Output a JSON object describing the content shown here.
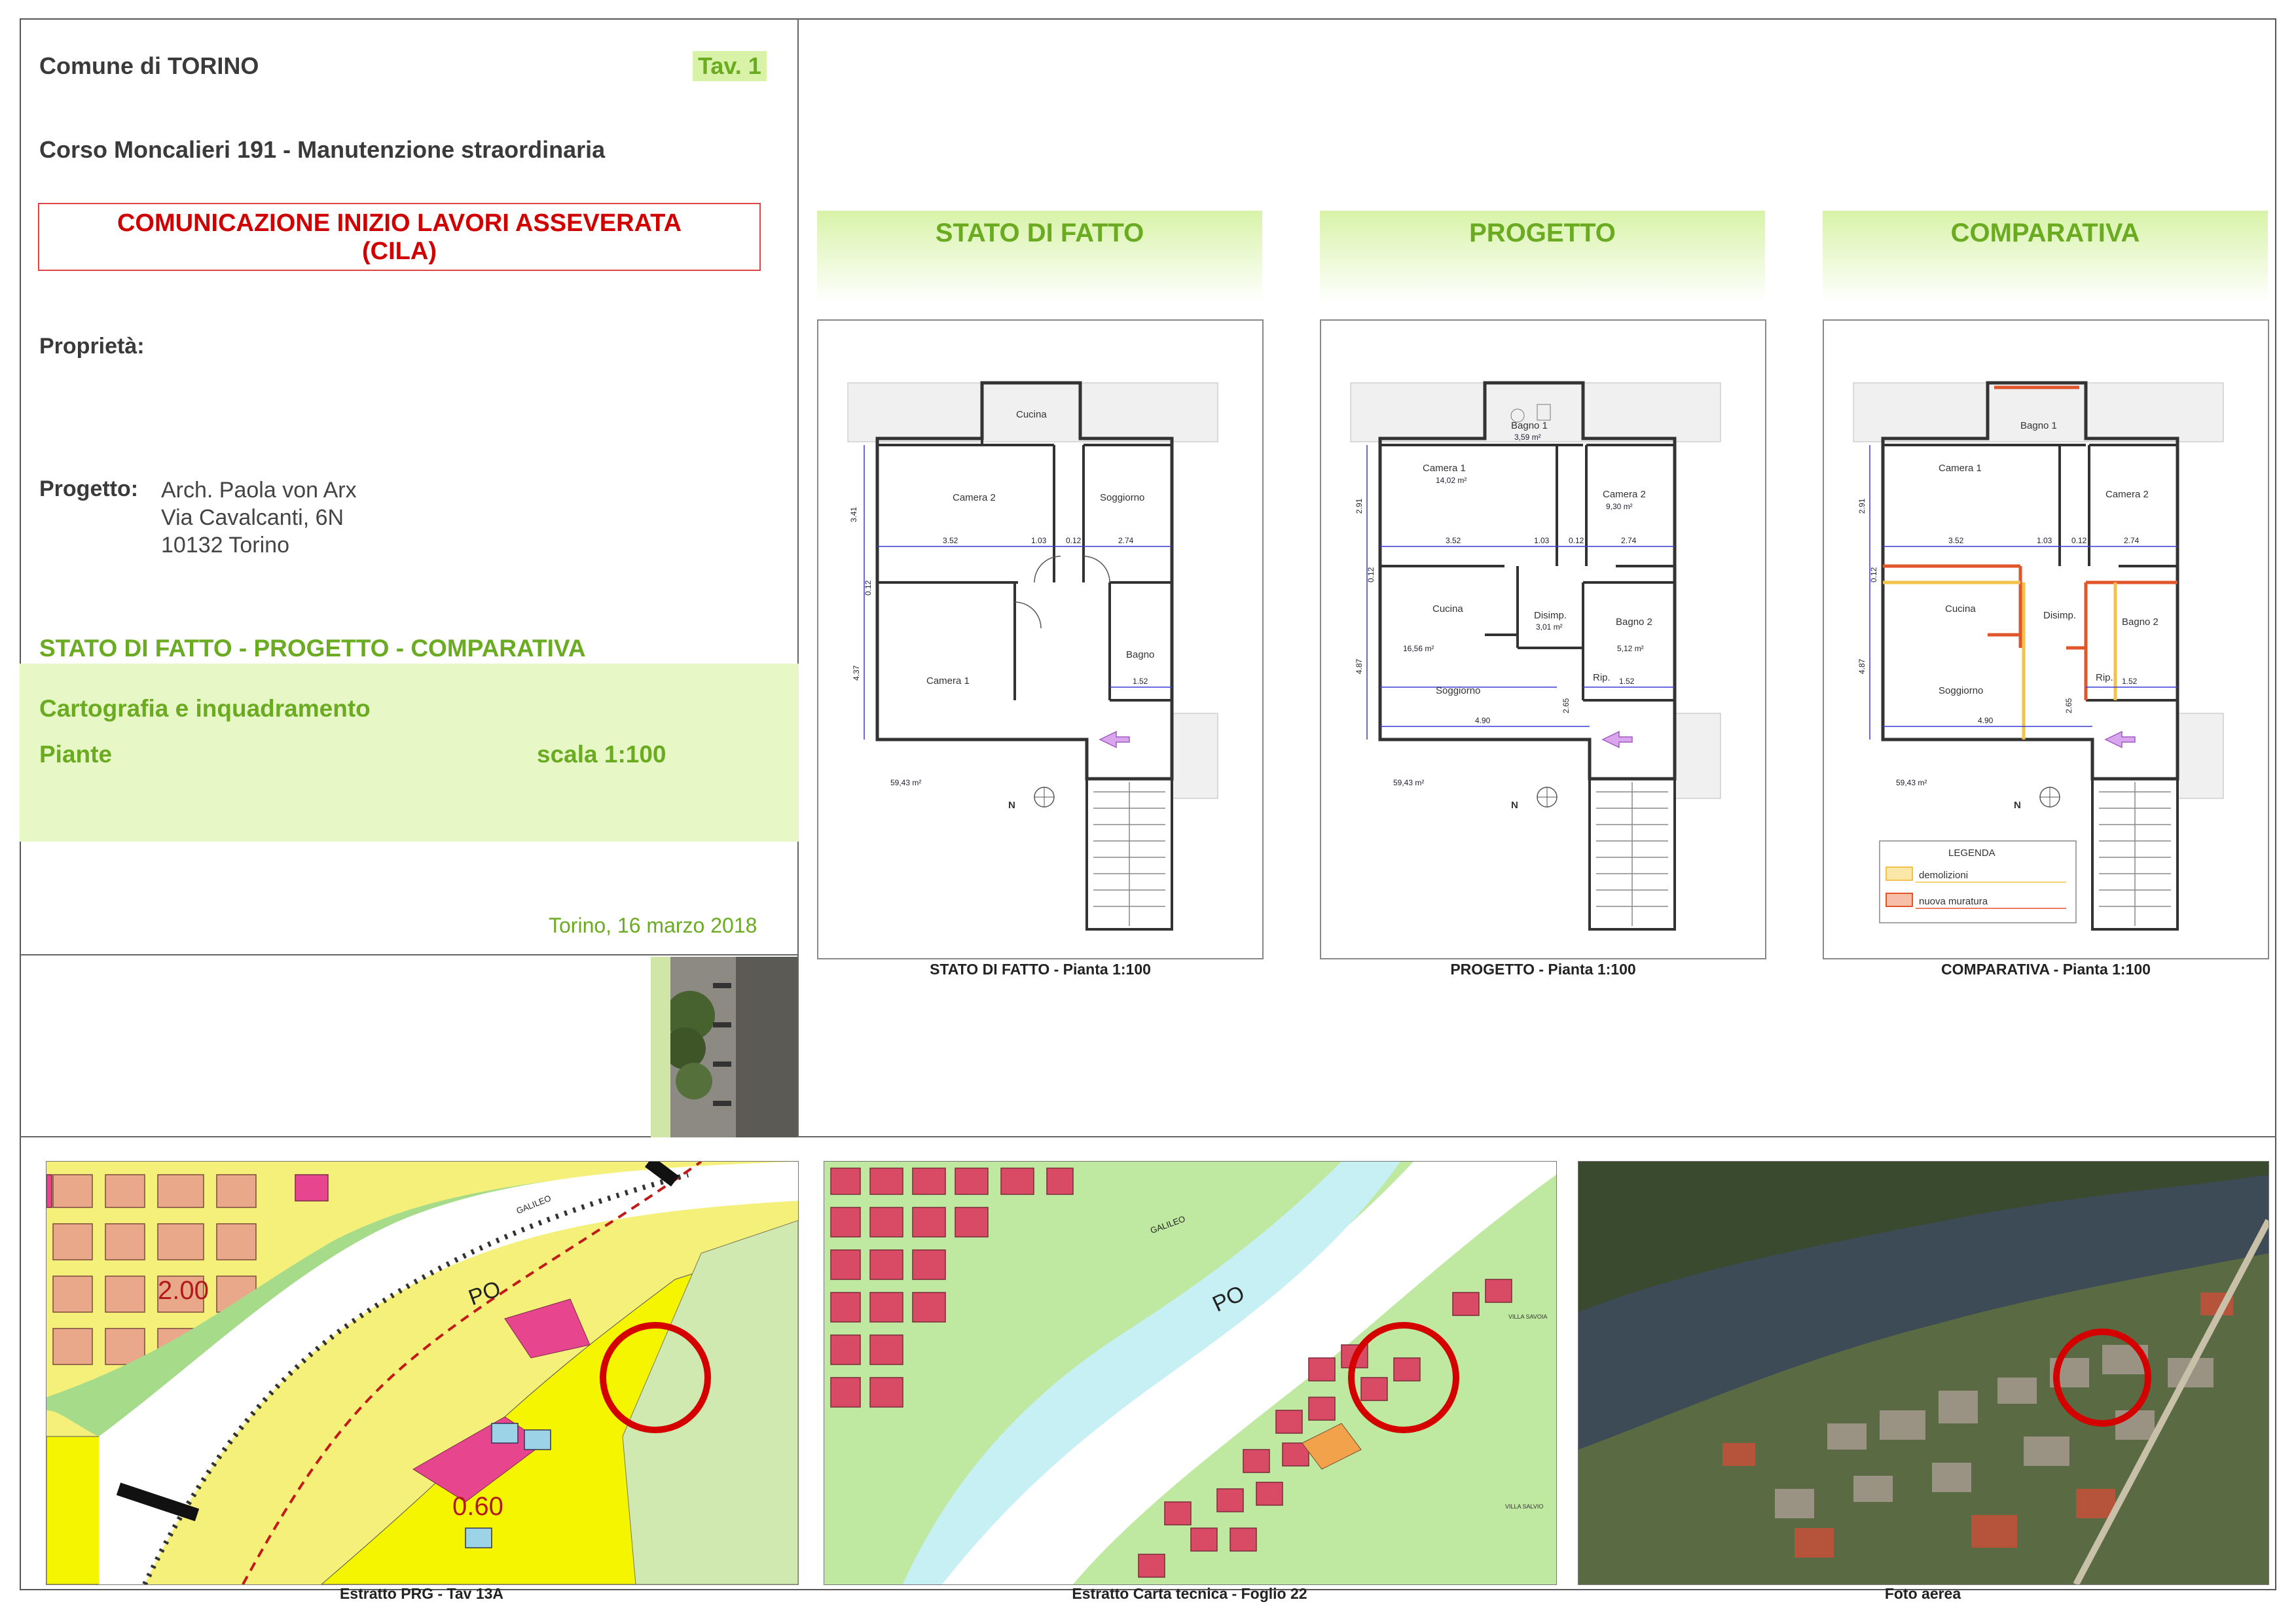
{
  "header": {
    "comune": "Comune di TORINO",
    "tav": "Tav. 1",
    "address": "Corso Moncalieri 191 - Manutenzione straordinaria",
    "cila_line1": "COMUNICAZIONE INIZIO LAVORI ASSEVERATA",
    "cila_line2": "(CILA)",
    "proprieta_label": "Proprietà:",
    "progetto_label": "Progetto:",
    "progetto_lines": [
      "Arch. Paola von Arx",
      "Via Cavalcanti, 6N",
      "10132 Torino"
    ],
    "section_title": "STATO DI FATTO - PROGETTO - COMPARATIVA",
    "content_1": "Cartografia e inquadramento",
    "content_2": "Piante",
    "scale": "scala 1:100",
    "date": "Torino, 16 marzo 2018"
  },
  "plans": [
    {
      "heading": "STATO DI FATTO",
      "caption": "STATO DI FATTO - Pianta 1:100",
      "rooms": [
        "Cucina",
        "Camera 2",
        "Soggiorno",
        "Camera 1",
        "Bagno"
      ],
      "dims": [
        "3.41",
        "3.52",
        "1.03",
        "0.12",
        "2.74",
        "0.12",
        "4.37",
        "1.52"
      ],
      "area": "59,43 m²"
    },
    {
      "heading": "PROGETTO",
      "caption": "PROGETTO - Pianta 1:100",
      "rooms": [
        "Bagno 1",
        "Camera 1",
        "Camera 2",
        "Cucina",
        "Disimp.",
        "Bagno 2",
        "Soggiorno",
        "Rip."
      ],
      "areas": [
        "3,59 m²",
        "14,02 m²",
        "9,30 m²",
        "16,56 m²",
        "3,01 m²",
        "5,12 m²"
      ],
      "dims": [
        "2.91",
        "3.52",
        "1.03",
        "0.12",
        "2.74",
        "0.12",
        "4.87",
        "2.65",
        "1.52",
        "4.90"
      ],
      "area": "59,43 m²"
    },
    {
      "heading": "COMPARATIVA",
      "caption": "COMPARATIVA - Pianta 1:100",
      "rooms": [
        "Bagno 1",
        "Camera 1",
        "Camera 2",
        "Cucina",
        "Disimp.",
        "Bagno 2",
        "Soggiorno",
        "Rip."
      ],
      "dims": [
        "2.91",
        "3.52",
        "1.03",
        "0.12",
        "2.74",
        "0.12",
        "4.87",
        "2.65",
        "1.52",
        "4.90"
      ],
      "area": "59,43 m²",
      "legend_title": "LEGENDA",
      "legend_items": [
        "demolizioni",
        "nuova muratura"
      ],
      "legend_colors": [
        "#f2c24a",
        "#e0552a"
      ]
    }
  ],
  "maps": [
    {
      "caption": "Estratto PRG - Tav 13A",
      "labels": [
        "2.00",
        "0.60",
        "PO",
        "GALILEO"
      ]
    },
    {
      "caption": "Estratto Carta tecnica - Foglio 22",
      "labels": [
        "PO",
        "GALILEO",
        "VILLA SAVOIA",
        "VILLA SALVIO"
      ]
    },
    {
      "caption": "Foto aerea",
      "labels": []
    }
  ],
  "colors": {
    "green_text": "#6aab22",
    "red_text": "#d10000",
    "green_band": "#e7f8c6",
    "marker_red": "#d40000"
  }
}
